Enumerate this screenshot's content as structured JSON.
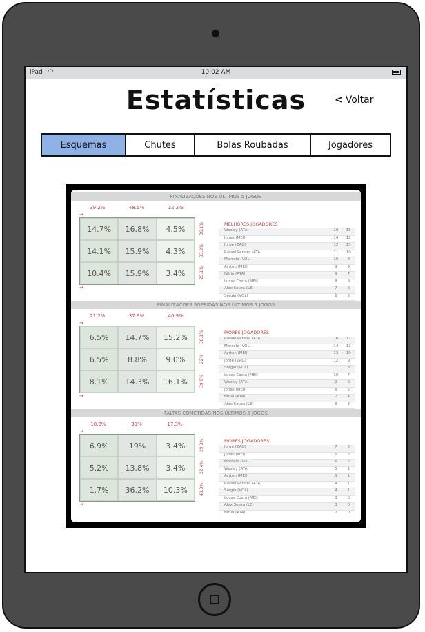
{
  "statusbar": {
    "carrier": "iPad",
    "time": "10:02 AM"
  },
  "header": {
    "title": "Estatísticas",
    "back_label": "Voltar"
  },
  "tabs": [
    {
      "label": "Esquemas",
      "active": true
    },
    {
      "label": "Chutes",
      "active": false
    },
    {
      "label": "Bolas Roubadas",
      "active": false
    },
    {
      "label": "Jogadores",
      "active": false
    }
  ],
  "colors": {
    "accent": "#8fb1e6",
    "device": "#4a4a4a"
  },
  "sections": [
    {
      "heading": "FINALIZAÇÕES NOS ÚLTIMOS 5 JOGOS",
      "top_pcts": [
        "39.2%",
        "48.5%",
        "12.2%"
      ],
      "cells": [
        "14.7%",
        "16.8%",
        "4.5%",
        "14.1%",
        "15.9%",
        "4.3%",
        "10.4%",
        "15.9%",
        "3.4%"
      ],
      "side_pcts": [
        "36.1%",
        "33.2%",
        "25.1%"
      ],
      "table_title": "MELHORES JOGADORES",
      "rows": [
        {
          "name": "Wesley (ATA)",
          "a": "10",
          "b": "15"
        },
        {
          "name": "Jonas (MEI)",
          "a": "14",
          "b": "12"
        },
        {
          "name": "Jorge (ZAG)",
          "a": "12",
          "b": "13"
        },
        {
          "name": "Rafael Pereira (ATA)",
          "a": "11",
          "b": "10"
        },
        {
          "name": "Marcelo (VOL)",
          "a": "10",
          "b": "8"
        },
        {
          "name": "Ayrton (MEI)",
          "a": "9",
          "b": "9"
        },
        {
          "name": "Fábio (ATA)",
          "a": "9",
          "b": "7"
        },
        {
          "name": "Lucas Costa (MEI)",
          "a": "8",
          "b": "8"
        },
        {
          "name": "Alex Souza (LE)",
          "a": "7",
          "b": "6"
        },
        {
          "name": "Sérgio (VOL)",
          "a": "6",
          "b": "5"
        }
      ]
    },
    {
      "heading": "FINALIZAÇÕES SOFRIDAS NOS ÚLTIMOS 5 JOGOS",
      "top_pcts": [
        "21.2%",
        "37.9%",
        "40.9%"
      ],
      "cells": [
        "6.5%",
        "14.7%",
        "15.2%",
        "6.5%",
        "8.8%",
        "9.0%",
        "8.1%",
        "14.3%",
        "16.1%"
      ],
      "side_pcts": [
        "38.1%",
        "22%",
        "39.9%"
      ],
      "table_title": "PIORES JOGADORES",
      "rows": [
        {
          "name": "Rafael Pereira (ATA)",
          "a": "16",
          "b": "12"
        },
        {
          "name": "Marcelo (VOL)",
          "a": "14",
          "b": "11"
        },
        {
          "name": "Ayrton (MEI)",
          "a": "13",
          "b": "10"
        },
        {
          "name": "Jorge (ZAG)",
          "a": "12",
          "b": "9"
        },
        {
          "name": "Sérgio (VOL)",
          "a": "11",
          "b": "8"
        },
        {
          "name": "Lucas Costa (MEI)",
          "a": "10",
          "b": "7"
        },
        {
          "name": "Wesley (ATA)",
          "a": "9",
          "b": "6"
        },
        {
          "name": "Jonas (MEI)",
          "a": "8",
          "b": "5"
        },
        {
          "name": "Fábio (ATA)",
          "a": "7",
          "b": "4"
        },
        {
          "name": "Alex Souza (LE)",
          "a": "6",
          "b": "3"
        }
      ]
    },
    {
      "heading": "FALTAS COMETIDAS NOS ÚLTIMOS 5 JOGOS",
      "top_pcts": [
        "18.3%",
        "39%",
        "17.3%"
      ],
      "cells": [
        "6.9%",
        "19%",
        "3.4%",
        "5.2%",
        "13.8%",
        "3.4%",
        "1.7%",
        "36.2%",
        "10.3%"
      ],
      "side_pcts": [
        "29.3%",
        "22.4%",
        "48.3%"
      ],
      "table_title": "PIORES JOGADORES",
      "rows": [
        {
          "name": "Jorge (ZAG)",
          "a": "7",
          "b": "3"
        },
        {
          "name": "Jonas (MEI)",
          "a": "6",
          "b": "2"
        },
        {
          "name": "Marcelo (VOL)",
          "a": "6",
          "b": "2"
        },
        {
          "name": "Wesley (ATA)",
          "a": "5",
          "b": "1"
        },
        {
          "name": "Ayrton (MEI)",
          "a": "5",
          "b": "1"
        },
        {
          "name": "Rafael Pereira (ATA)",
          "a": "4",
          "b": "1"
        },
        {
          "name": "Sérgio (VOL)",
          "a": "4",
          "b": "1"
        },
        {
          "name": "Lucas Costa (MEI)",
          "a": "3",
          "b": "0"
        },
        {
          "name": "Alex Souza (LE)",
          "a": "3",
          "b": "0"
        },
        {
          "name": "Fábio (ATA)",
          "a": "2",
          "b": "0"
        }
      ]
    }
  ]
}
